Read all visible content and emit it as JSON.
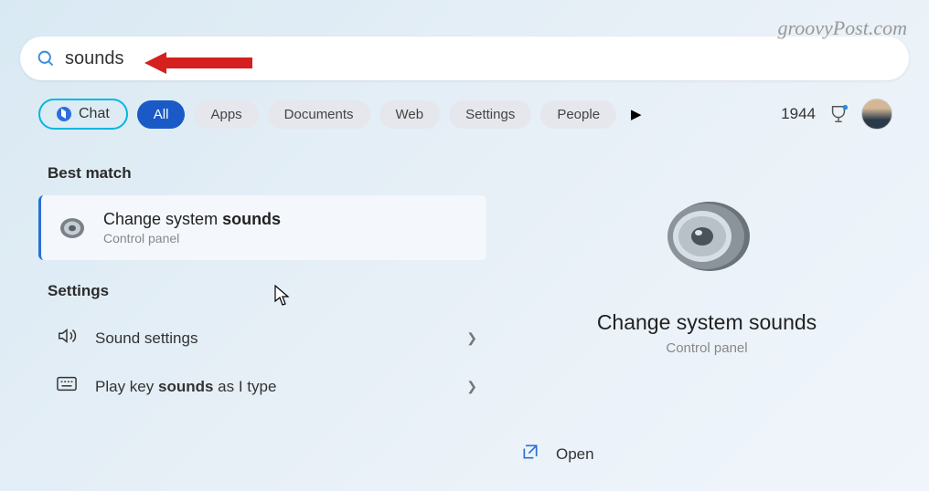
{
  "watermark": "groovyPost.com",
  "search": {
    "query": "sounds"
  },
  "filters": {
    "chat": "Chat",
    "items": [
      "All",
      "Apps",
      "Documents",
      "Web",
      "Settings",
      "People"
    ],
    "active_index": 0
  },
  "rewards": {
    "points": "1944"
  },
  "results": {
    "best_match_heading": "Best match",
    "best_match": {
      "title_prefix": "Change system ",
      "title_bold": "sounds",
      "subtitle": "Control panel"
    },
    "settings_heading": "Settings",
    "settings_items": [
      {
        "text_prefix": "",
        "text_bold": "",
        "text_plain": "Sound settings",
        "icon": "speaker"
      },
      {
        "text_prefix": "Play key ",
        "text_bold": "sounds",
        "text_suffix": " as I type",
        "icon": "keyboard"
      }
    ]
  },
  "details": {
    "title": "Change system sounds",
    "subtitle": "Control panel",
    "open_label": "Open"
  }
}
